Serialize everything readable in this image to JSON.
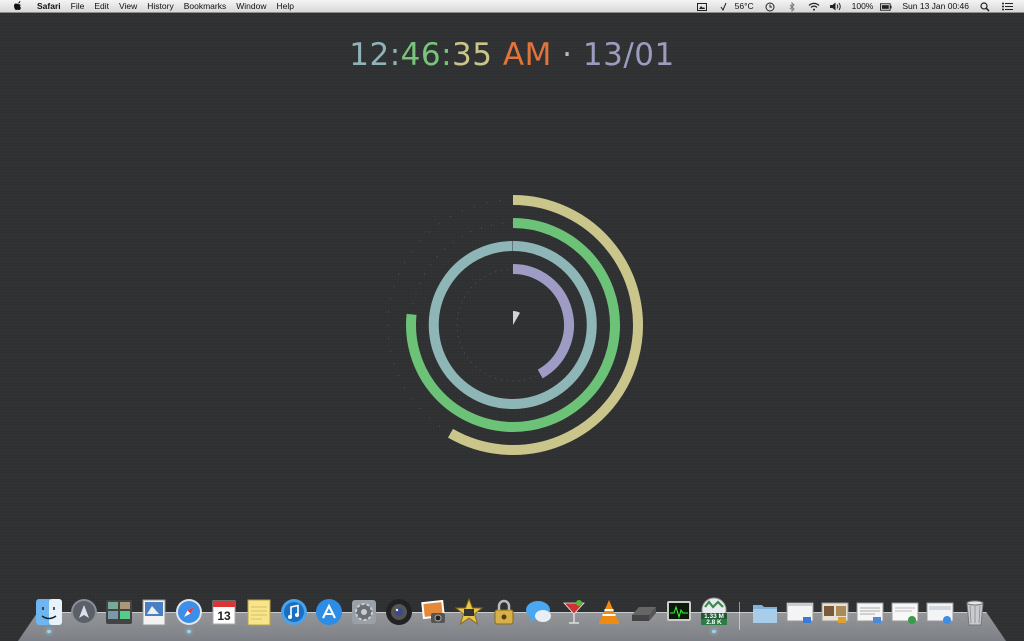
{
  "menubar": {
    "app_name": "Safari",
    "items": [
      "File",
      "Edit",
      "View",
      "History",
      "Bookmarks",
      "Window",
      "Help"
    ],
    "status": {
      "temperature": "56°C",
      "battery": "100%",
      "datetime": "Sun 13 Jan  00:46"
    }
  },
  "clock": {
    "hours": "12",
    "minutes": "46",
    "seconds": "35",
    "ampm": "AM",
    "separator": "·",
    "day": "13",
    "month": "01",
    "colors": {
      "hours": "#8fb3b8",
      "minutes": "#78c47c",
      "seconds": "#c9c58b",
      "ampm": "#e0743a",
      "separator": "#bbbbbb",
      "date": "#9c9cc0"
    }
  },
  "rings": {
    "colors": {
      "outer": "#c9c58b",
      "second": "#6cc377",
      "third": "#8fb6b7",
      "inner": "#9e9cc4",
      "center": "#d4d4d4"
    }
  },
  "dock": {
    "apps": [
      "finder-icon",
      "launchpad-icon",
      "mission-control-icon",
      "preview-icon",
      "safari-icon",
      "calendar-icon",
      "notes-icon",
      "itunes-icon",
      "app-store-icon",
      "system-preferences-icon",
      "photo-booth-icon",
      "iphoto-icon",
      "imovie-icon",
      "keychain-icon",
      "messages-icon",
      "cocktail-icon",
      "vlc-icon",
      "drive-icon",
      "activity-monitor-icon",
      "network-stats-icon"
    ],
    "calendar_day": "13",
    "network_up": "1.33 M",
    "network_down": "2.8 K"
  }
}
